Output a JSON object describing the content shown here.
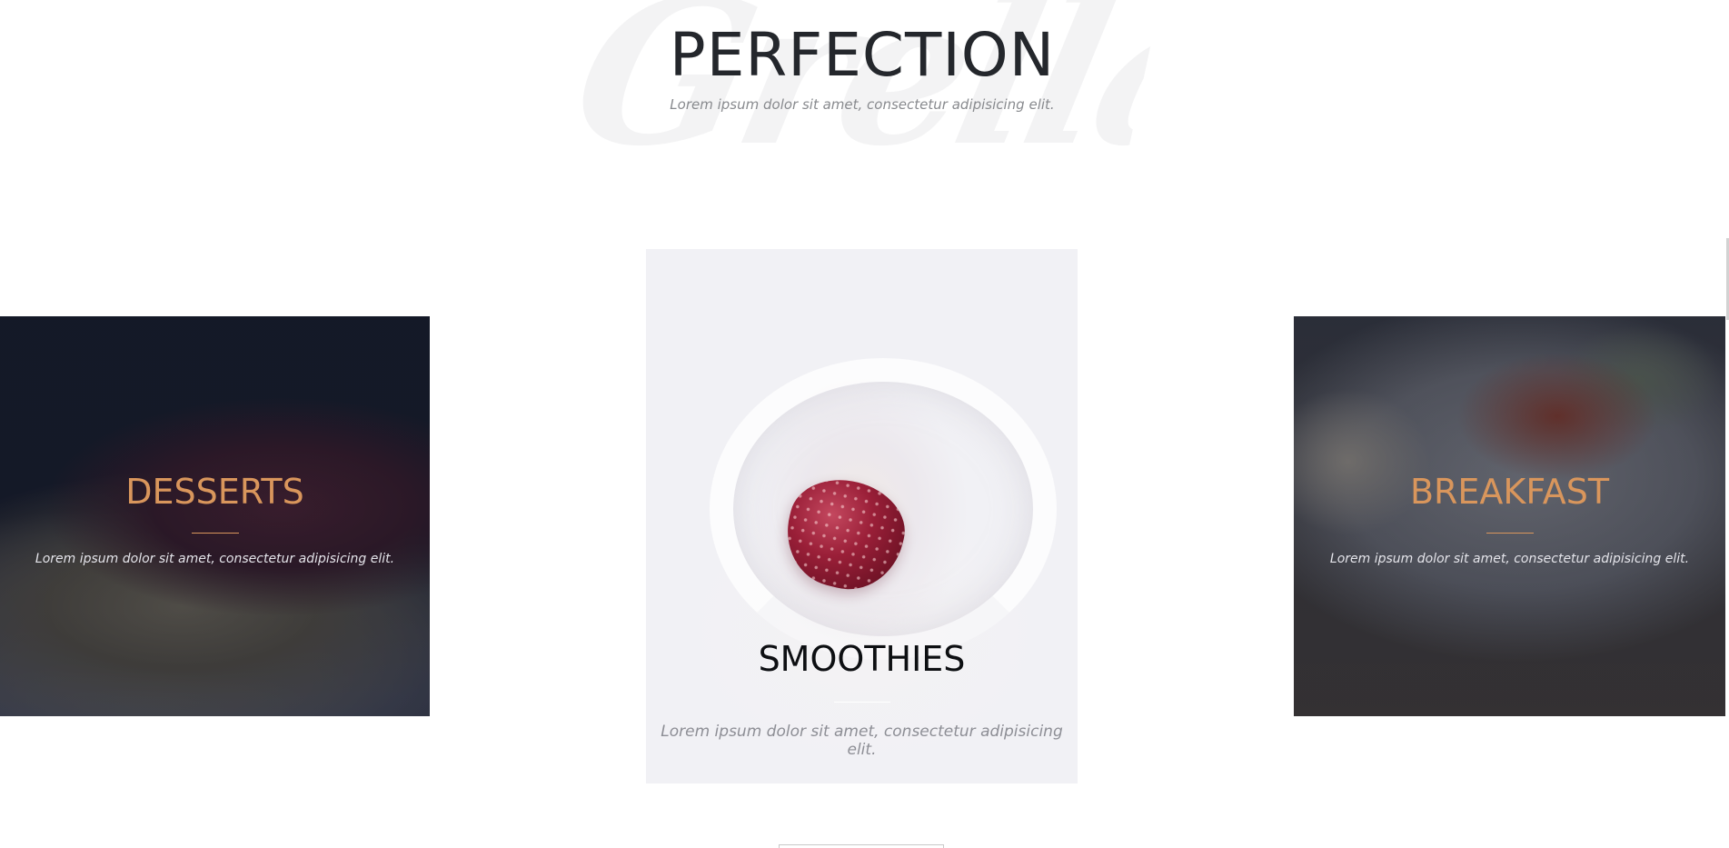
{
  "header": {
    "watermark": "Grella",
    "title": "PERFECTION",
    "subtitle": "Lorem ipsum dolor sit amet, consectetur adipisicing elit."
  },
  "cards": [
    {
      "title": "DESSERTS",
      "text": "Lorem ipsum dolor sit amet, consectetur adipisicing elit."
    },
    {
      "title": "SMOOTHIES",
      "text": "Lorem ipsum dolor sit amet, consectetur adipisicing elit."
    },
    {
      "title": "BREAKFAST",
      "text": "Lorem ipsum dolor sit amet, consectetur adipisicing elit."
    }
  ],
  "colors": {
    "accent": "#d9965c",
    "title_dark": "#24272c",
    "muted_text": "#888a8e"
  }
}
